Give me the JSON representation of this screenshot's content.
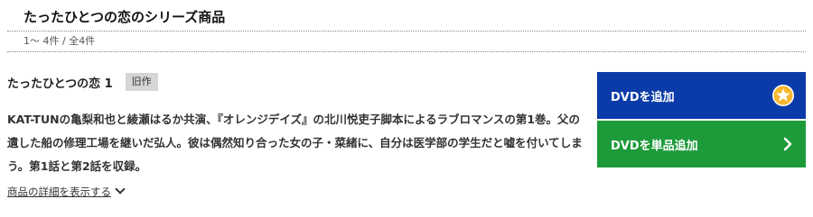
{
  "series": {
    "title": "たったひとつの恋のシリーズ商品",
    "count_text": "1〜 4件 / 全4件"
  },
  "item": {
    "title": "たったひとつの恋 1",
    "badge": "旧作",
    "description": "KAT-TUNの亀梨和也と綾瀬はるか共演、『オレンジデイズ』の北川悦吏子脚本によるラブロマンスの第1巻。父の遺した船の修理工場を継いだ弘人。彼は偶然知り合った女の子・菜緒に、自分は医学部の学生だと嘘を付いてしまう。第1話と第2話を収録。",
    "details_link": "商品の詳細を表示する"
  },
  "actions": {
    "add_dvd": {
      "label": "DVDを追加",
      "icon": "star-icon",
      "color": "#0b3ba8"
    },
    "add_single_dvd": {
      "label": "DVDを単品追加",
      "icon": "chevron-right-icon",
      "color": "#1d9b3a"
    }
  },
  "colors": {
    "star_fill": "#f5b82e",
    "badge_bg": "#d6d6d6"
  }
}
